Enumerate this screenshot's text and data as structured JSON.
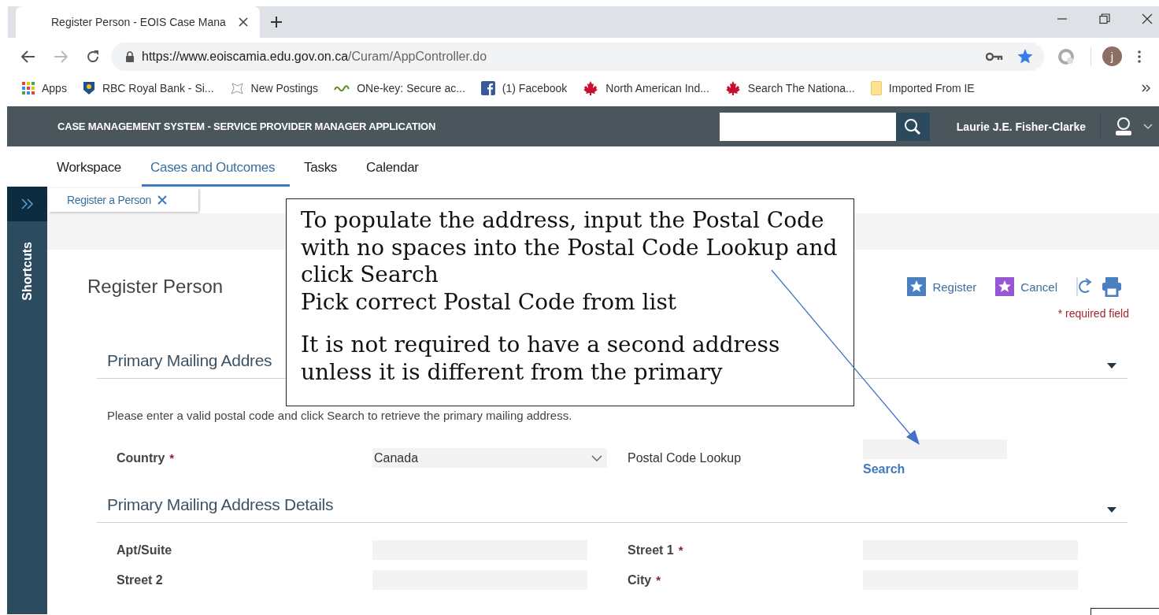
{
  "browser": {
    "tab_title": "Register Person - EOIS Case Mana",
    "url_host": "https://www.eoiscamia.edu.gov.on.ca",
    "url_path": "/Curam/AppController.do",
    "avatar_letter": "j",
    "bookmarks": [
      {
        "label": "Apps",
        "kind": "apps"
      },
      {
        "label": "RBC Royal Bank - Si...",
        "kind": "bank"
      },
      {
        "label": "New Postings",
        "kind": "postings"
      },
      {
        "label": "ONe-key: Secure ac...",
        "kind": "onekey"
      },
      {
        "label": "(1) Facebook",
        "kind": "facebook"
      },
      {
        "label": "North American Ind...",
        "kind": "maple"
      },
      {
        "label": "Search The Nationa...",
        "kind": "maple"
      },
      {
        "label": "Imported From IE",
        "kind": "folder"
      }
    ]
  },
  "app": {
    "title": "CASE MANAGEMENT SYSTEM - SERVICE PROVIDER MANAGER APPLICATION",
    "user_name": "Laurie J.E. Fisher-Clarke",
    "nav": [
      {
        "label": "Workspace",
        "selected": false
      },
      {
        "label": "Cases and Outcomes",
        "selected": true
      },
      {
        "label": "Tasks",
        "selected": false
      },
      {
        "label": "Calendar",
        "selected": false
      }
    ],
    "sidebar_label": "Shortcuts",
    "open_tabs": [
      {
        "label": "Register a Person"
      }
    ],
    "page_title": "Register Person",
    "actions": [
      {
        "label": "Register",
        "kind": "register"
      },
      {
        "label": "Cancel",
        "kind": "cancel"
      },
      {
        "kind": "refresh"
      },
      {
        "kind": "print"
      }
    ],
    "required_note": "* required field",
    "sections": [
      {
        "title": "Primary Mailing Addres",
        "expanded": true,
        "instruction": "Please enter a valid postal code and click Search to retrieve the primary mailing address.",
        "rows": [
          [
            {
              "label": "Country",
              "required": true,
              "marker": "*",
              "kind": "select",
              "value": "Canada"
            },
            {
              "label": "Postal Code Lookup",
              "required": false,
              "kind": "lookup",
              "link": "Search"
            }
          ]
        ]
      },
      {
        "title": "Primary Mailing Address Details",
        "expanded": true,
        "rows": [
          [
            {
              "label": "Apt/Suite",
              "required": false,
              "kind": "text"
            },
            {
              "label": "Street 1",
              "required": true,
              "marker": "*",
              "kind": "text"
            }
          ],
          [
            {
              "label": "Street 2",
              "required": false,
              "kind": "text"
            },
            {
              "label": "City",
              "required": true,
              "marker": "*",
              "kind": "text"
            }
          ]
        ]
      }
    ]
  },
  "callout": {
    "blocks": [
      [
        "To populate the address, input the Postal Code with no spaces into the Postal Code Lookup and click Search",
        "Pick correct Postal Code from list"
      ],
      [
        "It is not required to have a second address unless it is different from the primary"
      ]
    ]
  }
}
